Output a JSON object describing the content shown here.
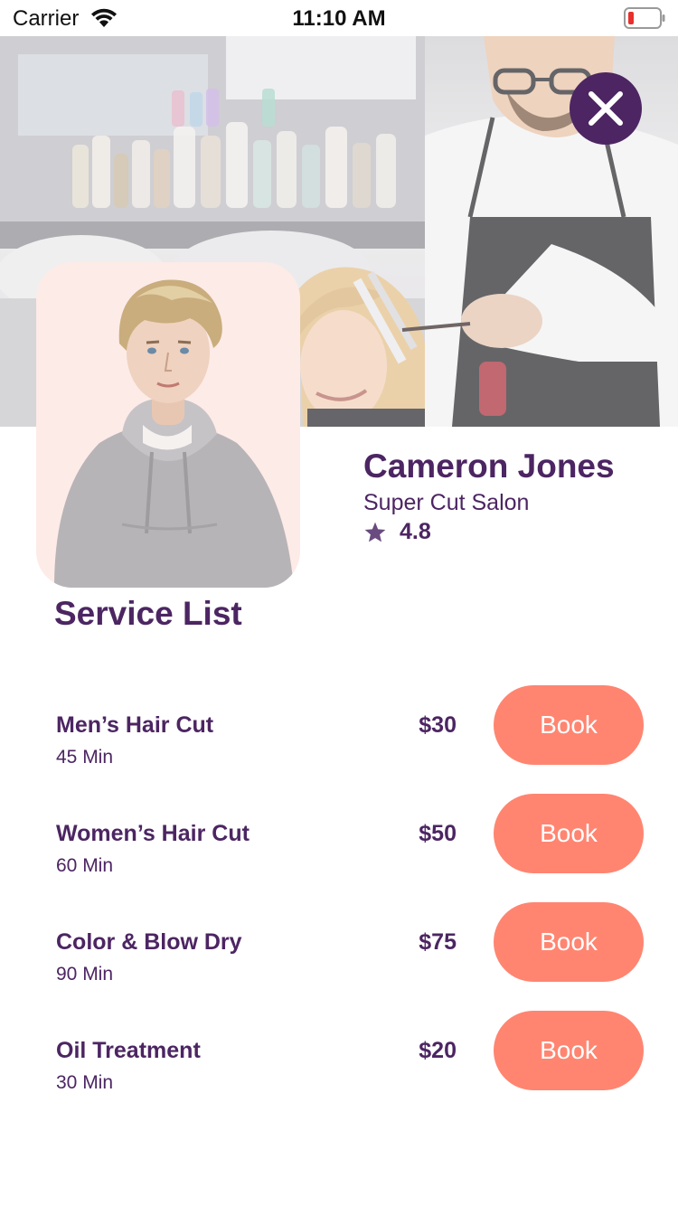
{
  "status_bar": {
    "carrier": "Carrier",
    "time": "11:10 AM",
    "battery_color": "#e8302c"
  },
  "hero": {
    "icon": "salon-photo"
  },
  "close_button": {
    "icon": "close-icon",
    "color": "#4c2562"
  },
  "stylist": {
    "name": "Cameron Jones",
    "salon": "Super Cut Salon",
    "rating": "4.8",
    "rating_icon": "star-icon"
  },
  "services": {
    "title": "Service List",
    "items": [
      {
        "name": "Men’s Hair Cut",
        "duration": "45 Min",
        "price": "$30",
        "button": "Book"
      },
      {
        "name": "Women’s Hair Cut",
        "duration": "60 Min",
        "price": "$50",
        "button": "Book"
      },
      {
        "name": "Color & Blow Dry",
        "duration": "90 Min",
        "price": "$75",
        "button": "Book"
      },
      {
        "name": "Oil Treatment",
        "duration": "30 Min",
        "price": "$20",
        "button": "Book"
      }
    ]
  },
  "colors": {
    "brand": "#4c2562",
    "accent": "#ff8571",
    "avatar_background": "#fdebe7"
  }
}
